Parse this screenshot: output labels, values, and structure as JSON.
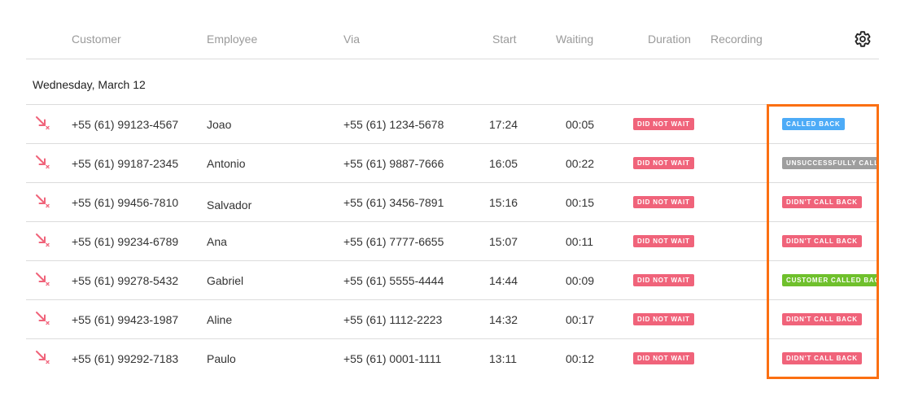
{
  "columns": {
    "customer": "Customer",
    "employee": "Employee",
    "via": "Via",
    "start": "Start",
    "waiting": "Waiting",
    "duration": "Duration",
    "recording": "Recording"
  },
  "settings_icon": "gear-icon",
  "group": {
    "date": "Wednesday, March 12"
  },
  "rows": [
    {
      "customer": "+55 (61) 99123-4567",
      "employee": "Joao",
      "via": "+55 (61) 1234-5678",
      "start": "17:24",
      "waiting": "00:05",
      "duration": "DID NOT WAIT",
      "status": "CALLED BACK",
      "status_color": "#4dabf7"
    },
    {
      "customer": "+55 (61) 99187-2345",
      "employee": "Antonio",
      "via": "+55 (61) 9887-7666",
      "start": "16:05",
      "waiting": "00:22",
      "duration": "DID NOT WAIT",
      "status": "UNSUCCESSFULLY CALLED BACK",
      "status_color": "#9e9e9e"
    },
    {
      "customer": "+55 (61) 99456-7810",
      "employee": "Salvador",
      "via": "+55 (61) 3456-7891",
      "start": "15:16",
      "waiting": "00:15",
      "duration": "DID NOT WAIT",
      "status": "DIDN'T CALL BACK",
      "status_color": "#f0637a"
    },
    {
      "customer": "+55 (61) 99234-6789",
      "employee": "Ana",
      "via": "+55 (61) 7777-6655",
      "start": "15:07",
      "waiting": "00:11",
      "duration": "DID NOT WAIT",
      "status": "DIDN'T CALL BACK",
      "status_color": "#f0637a"
    },
    {
      "customer": "+55 (61) 99278-5432",
      "employee": "Gabriel",
      "via": "+55 (61) 5555-4444",
      "start": "14:44",
      "waiting": "00:09",
      "duration": "DID NOT WAIT",
      "status": "CUSTOMER CALLED BACK",
      "status_color": "#6fc02c"
    },
    {
      "customer": "+55 (61) 99423-1987",
      "employee": "Aline",
      "via": "+55 (61) 1112-2223",
      "start": "14:32",
      "waiting": "00:17",
      "duration": "DID NOT WAIT",
      "status": "DIDN'T CALL BACK",
      "status_color": "#f0637a"
    },
    {
      "customer": "+55 (61) 99292-7183",
      "employee": "Paulo",
      "via": "+55 (61) 0001-1111",
      "start": "13:11",
      "waiting": "00:12",
      "duration": "DID NOT WAIT",
      "status": "DIDN'T CALL BACK",
      "status_color": "#f0637a"
    }
  ],
  "row_icon": "missed-call-icon",
  "colors": {
    "highlight": "#fb6f12",
    "missed_icon": "#f0637a"
  }
}
